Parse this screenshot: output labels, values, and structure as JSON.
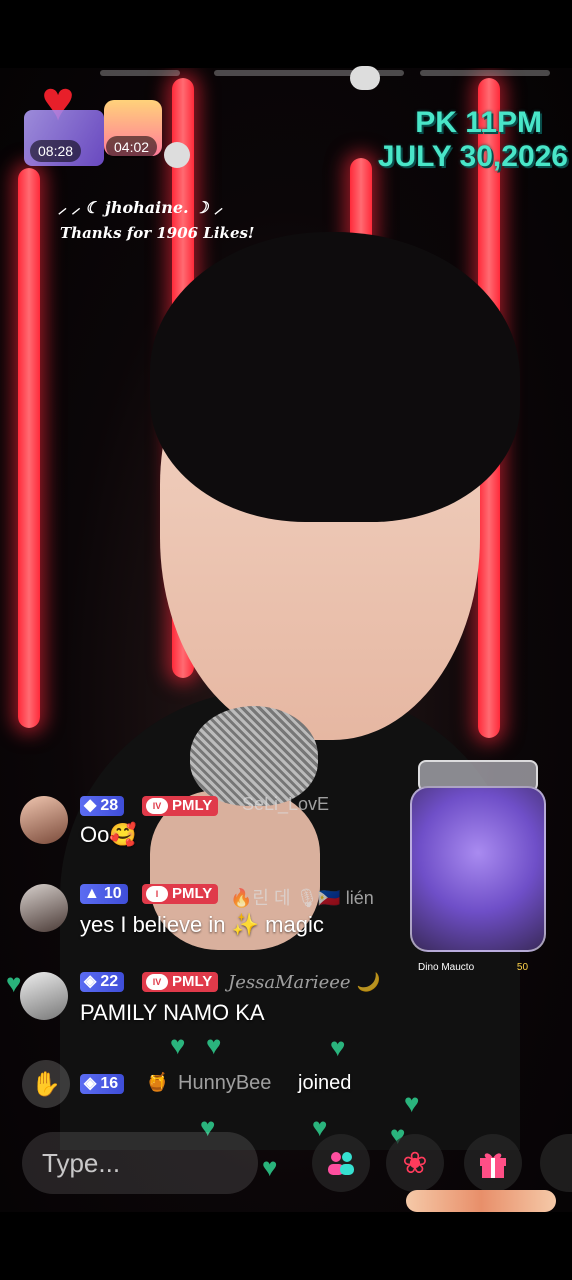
{
  "overlay": {
    "timer_left": "08:28",
    "timer_right": "04:02",
    "pk_line1": "PK 11PM",
    "pk_line2": "JULY 30,2026"
  },
  "thanks": {
    "line1": "⸝ ⸝ ☾ jhohaine. ☽ ⸝",
    "line2": "Thanks for 1906 Likes!"
  },
  "chat": [
    {
      "level": "28",
      "team": "PMLY",
      "user": "SeLi_LovE",
      "message": "Oo🥰"
    },
    {
      "level": "10",
      "team": "PMLY",
      "user": "🔥린 데 🎙🇵🇭 lién",
      "message": "yes I believe in ✨ magic"
    },
    {
      "level": "22",
      "team": "PMLY",
      "user": "JessaMarieee 🌙",
      "message": "PAMILY NAMO KA"
    }
  ],
  "join": {
    "level": "16",
    "user": "HunnyBee",
    "action": "joined"
  },
  "pk_mini": {
    "name": "Dino Maucto",
    "score": "50"
  },
  "input": {
    "placeholder": "Type..."
  },
  "icons": {
    "wave": "wave-icon",
    "people": "people-icon",
    "rose": "rose-icon",
    "gift": "gift-icon"
  },
  "colors": {
    "accent_teal": "#49e6c8",
    "neon_red": "#ff2a3a",
    "level_badge": "#4f5ee6",
    "team_badge": "#e03a4a"
  }
}
